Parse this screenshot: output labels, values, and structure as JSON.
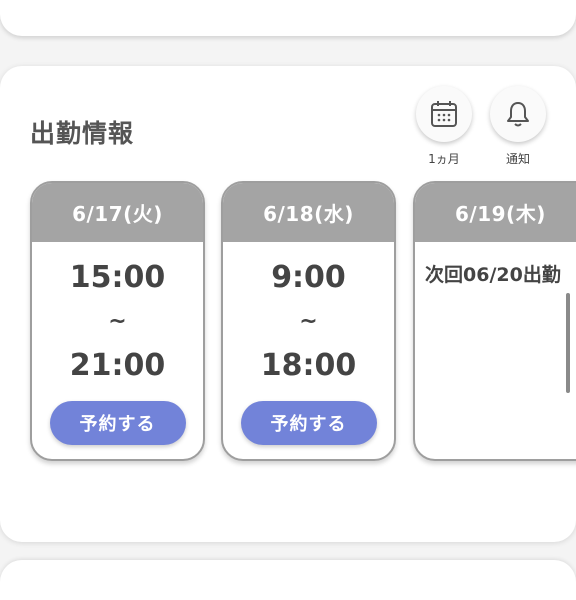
{
  "section": {
    "title": "出勤情報"
  },
  "actions": {
    "calendar_label": "1ヵ月",
    "notify_label": "通知"
  },
  "schedule": [
    {
      "date": "6/17(火)",
      "start": "15:00",
      "separator": "~",
      "end": "21:00",
      "button": "予約する"
    },
    {
      "date": "6/18(水)",
      "start": "9:00",
      "separator": "~",
      "end": "18:00",
      "button": "予約する"
    },
    {
      "date": "6/19(木)",
      "note": "次回06/20出勤"
    }
  ],
  "colors": {
    "header_bg": "#a4a4a4",
    "button_bg": "#7283d9",
    "card_border": "#9e9e9e"
  },
  "icons": [
    "calendar-icon",
    "bell-icon"
  ]
}
